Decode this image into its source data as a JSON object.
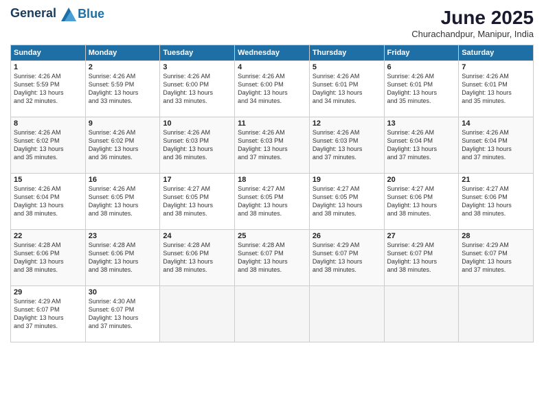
{
  "header": {
    "logo_line1": "General",
    "logo_line2": "Blue",
    "title": "June 2025",
    "location": "Churachandpur, Manipur, India"
  },
  "weekdays": [
    "Sunday",
    "Monday",
    "Tuesday",
    "Wednesday",
    "Thursday",
    "Friday",
    "Saturday"
  ],
  "weeks": [
    [
      {
        "day": "1",
        "info": "Sunrise: 4:26 AM\nSunset: 5:59 PM\nDaylight: 13 hours\nand 32 minutes."
      },
      {
        "day": "2",
        "info": "Sunrise: 4:26 AM\nSunset: 5:59 PM\nDaylight: 13 hours\nand 33 minutes."
      },
      {
        "day": "3",
        "info": "Sunrise: 4:26 AM\nSunset: 6:00 PM\nDaylight: 13 hours\nand 33 minutes."
      },
      {
        "day": "4",
        "info": "Sunrise: 4:26 AM\nSunset: 6:00 PM\nDaylight: 13 hours\nand 34 minutes."
      },
      {
        "day": "5",
        "info": "Sunrise: 4:26 AM\nSunset: 6:01 PM\nDaylight: 13 hours\nand 34 minutes."
      },
      {
        "day": "6",
        "info": "Sunrise: 4:26 AM\nSunset: 6:01 PM\nDaylight: 13 hours\nand 35 minutes."
      },
      {
        "day": "7",
        "info": "Sunrise: 4:26 AM\nSunset: 6:01 PM\nDaylight: 13 hours\nand 35 minutes."
      }
    ],
    [
      {
        "day": "8",
        "info": "Sunrise: 4:26 AM\nSunset: 6:02 PM\nDaylight: 13 hours\nand 35 minutes."
      },
      {
        "day": "9",
        "info": "Sunrise: 4:26 AM\nSunset: 6:02 PM\nDaylight: 13 hours\nand 36 minutes."
      },
      {
        "day": "10",
        "info": "Sunrise: 4:26 AM\nSunset: 6:03 PM\nDaylight: 13 hours\nand 36 minutes."
      },
      {
        "day": "11",
        "info": "Sunrise: 4:26 AM\nSunset: 6:03 PM\nDaylight: 13 hours\nand 37 minutes."
      },
      {
        "day": "12",
        "info": "Sunrise: 4:26 AM\nSunset: 6:03 PM\nDaylight: 13 hours\nand 37 minutes."
      },
      {
        "day": "13",
        "info": "Sunrise: 4:26 AM\nSunset: 6:04 PM\nDaylight: 13 hours\nand 37 minutes."
      },
      {
        "day": "14",
        "info": "Sunrise: 4:26 AM\nSunset: 6:04 PM\nDaylight: 13 hours\nand 37 minutes."
      }
    ],
    [
      {
        "day": "15",
        "info": "Sunrise: 4:26 AM\nSunset: 6:04 PM\nDaylight: 13 hours\nand 38 minutes."
      },
      {
        "day": "16",
        "info": "Sunrise: 4:26 AM\nSunset: 6:05 PM\nDaylight: 13 hours\nand 38 minutes."
      },
      {
        "day": "17",
        "info": "Sunrise: 4:27 AM\nSunset: 6:05 PM\nDaylight: 13 hours\nand 38 minutes."
      },
      {
        "day": "18",
        "info": "Sunrise: 4:27 AM\nSunset: 6:05 PM\nDaylight: 13 hours\nand 38 minutes."
      },
      {
        "day": "19",
        "info": "Sunrise: 4:27 AM\nSunset: 6:05 PM\nDaylight: 13 hours\nand 38 minutes."
      },
      {
        "day": "20",
        "info": "Sunrise: 4:27 AM\nSunset: 6:06 PM\nDaylight: 13 hours\nand 38 minutes."
      },
      {
        "day": "21",
        "info": "Sunrise: 4:27 AM\nSunset: 6:06 PM\nDaylight: 13 hours\nand 38 minutes."
      }
    ],
    [
      {
        "day": "22",
        "info": "Sunrise: 4:28 AM\nSunset: 6:06 PM\nDaylight: 13 hours\nand 38 minutes."
      },
      {
        "day": "23",
        "info": "Sunrise: 4:28 AM\nSunset: 6:06 PM\nDaylight: 13 hours\nand 38 minutes."
      },
      {
        "day": "24",
        "info": "Sunrise: 4:28 AM\nSunset: 6:06 PM\nDaylight: 13 hours\nand 38 minutes."
      },
      {
        "day": "25",
        "info": "Sunrise: 4:28 AM\nSunset: 6:07 PM\nDaylight: 13 hours\nand 38 minutes."
      },
      {
        "day": "26",
        "info": "Sunrise: 4:29 AM\nSunset: 6:07 PM\nDaylight: 13 hours\nand 38 minutes."
      },
      {
        "day": "27",
        "info": "Sunrise: 4:29 AM\nSunset: 6:07 PM\nDaylight: 13 hours\nand 38 minutes."
      },
      {
        "day": "28",
        "info": "Sunrise: 4:29 AM\nSunset: 6:07 PM\nDaylight: 13 hours\nand 37 minutes."
      }
    ],
    [
      {
        "day": "29",
        "info": "Sunrise: 4:29 AM\nSunset: 6:07 PM\nDaylight: 13 hours\nand 37 minutes."
      },
      {
        "day": "30",
        "info": "Sunrise: 4:30 AM\nSunset: 6:07 PM\nDaylight: 13 hours\nand 37 minutes."
      },
      {
        "day": "",
        "info": ""
      },
      {
        "day": "",
        "info": ""
      },
      {
        "day": "",
        "info": ""
      },
      {
        "day": "",
        "info": ""
      },
      {
        "day": "",
        "info": ""
      }
    ]
  ]
}
